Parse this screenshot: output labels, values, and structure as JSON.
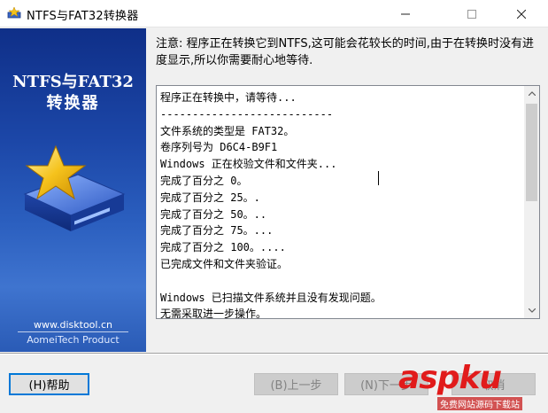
{
  "window": {
    "title": "NTFS与FAT32转换器",
    "controls": {
      "minimize": "—",
      "maximize": "☐",
      "close": "✕"
    }
  },
  "banner": {
    "title_line1": "NTFS与FAT32",
    "title_line2": "转换器",
    "url": "www.disktool.cn",
    "company": "AomeiTech Product",
    "graphic": "disk-star-icon"
  },
  "notice": "注意: 程序正在转换它到NTFS,这可能会花较长的时间,由于在转换时没有进度显示,所以你需要耐心地等待.",
  "log": {
    "lines": [
      "程序正在转换中，请等待...",
      "---------------------------",
      "文件系统的类型是 FAT32。",
      "卷序列号为 D6C4-B9F1",
      "Windows 正在校验文件和文件夹...",
      "完成了百分之 0。",
      "完成了百分之 25。.",
      "完成了百分之 50。..",
      "完成了百分之 75。...",
      "完成了百分之 100。....",
      "已完成文件和文件夹验证。",
      "",
      "Windows 已扫描文件系统并且没有发现问题。",
      "无需采取进一步操作。"
    ]
  },
  "buttons": {
    "help": "(H)帮助",
    "back": "(B)上一步",
    "next": "(N)下一步",
    "cancel": "取消"
  },
  "watermark": {
    "main": "aspku",
    "sub": "免费网站源码下载站"
  },
  "colors": {
    "banner_dark": "#0f2f88",
    "banner_light": "#3f74cf",
    "focus_border": "#0078d7",
    "watermark_red": "#e11b1b"
  }
}
